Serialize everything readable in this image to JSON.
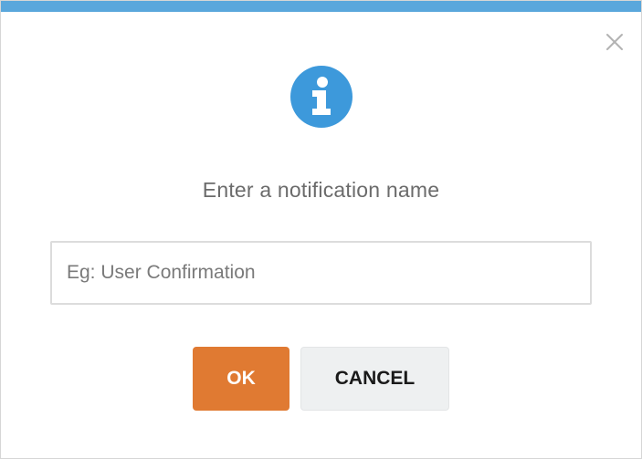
{
  "dialog": {
    "accent_color": "#5aa7dc",
    "close_icon": "close-icon",
    "info_icon": "info-icon",
    "info_icon_color": "#3d99db",
    "prompt": "Enter a notification name",
    "input": {
      "value": "",
      "placeholder": "Eg: User Confirmation"
    },
    "buttons": {
      "ok_label": "OK",
      "ok_color": "#e07a32",
      "cancel_label": "CANCEL",
      "cancel_color": "#eef0f1"
    }
  }
}
